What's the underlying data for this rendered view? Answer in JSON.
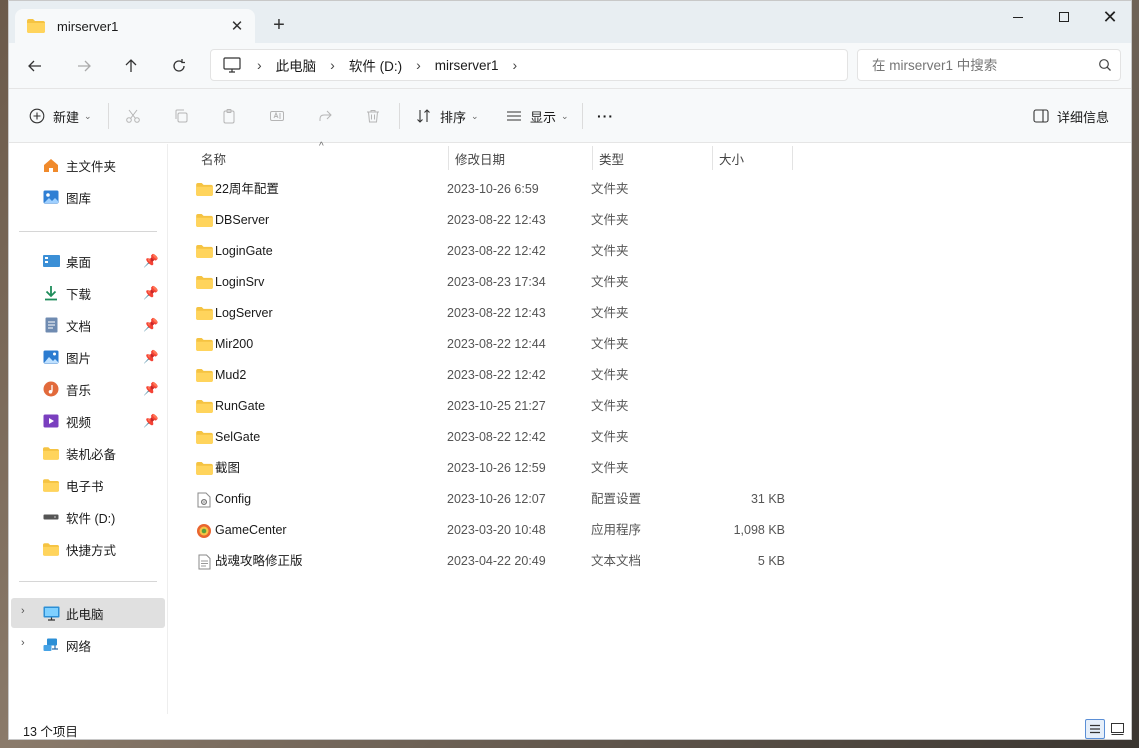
{
  "tab": {
    "title": "mirserver1",
    "close": "✕",
    "new_tab": "+"
  },
  "window_controls": {
    "minimize": "",
    "maximize": "",
    "close": "✕"
  },
  "breadcrumb": [
    "此电脑",
    "软件 (D:)",
    "mirserver1"
  ],
  "search": {
    "placeholder": "在 mirserver1 中搜索"
  },
  "toolbar": {
    "new_label": "新建",
    "sort_label": "排序",
    "view_label": "显示",
    "more_label": "···",
    "details_label": "详细信息"
  },
  "sidebar": {
    "items": [
      {
        "label": "主文件夹",
        "icon": "home-icon"
      },
      {
        "label": "图库",
        "icon": "gallery-icon"
      },
      {
        "label": "桌面",
        "icon": "desktop-icon",
        "pinned": true
      },
      {
        "label": "下载",
        "icon": "download-icon",
        "pinned": true
      },
      {
        "label": "文档",
        "icon": "document-icon",
        "pinned": true
      },
      {
        "label": "图片",
        "icon": "pictures-icon",
        "pinned": true
      },
      {
        "label": "音乐",
        "icon": "music-icon",
        "pinned": true
      },
      {
        "label": "视频",
        "icon": "video-icon",
        "pinned": true
      },
      {
        "label": "装机必备",
        "icon": "folder-icon"
      },
      {
        "label": "电子书",
        "icon": "folder-icon"
      },
      {
        "label": "软件 (D:)",
        "icon": "drive-icon"
      },
      {
        "label": "快捷方式",
        "icon": "folder-icon"
      },
      {
        "label": "此电脑",
        "icon": "this-pc-icon",
        "selected": true
      },
      {
        "label": "网络",
        "icon": "network-icon"
      }
    ]
  },
  "columns": {
    "name": "名称",
    "date": "修改日期",
    "type": "类型",
    "size": "大小"
  },
  "files": [
    {
      "name": "22周年配置",
      "date": "2023-10-26 6:59",
      "type": "文件夹",
      "size": "",
      "icon": "folder-icon"
    },
    {
      "name": "DBServer",
      "date": "2023-08-22 12:43",
      "type": "文件夹",
      "size": "",
      "icon": "folder-icon"
    },
    {
      "name": "LoginGate",
      "date": "2023-08-22 12:42",
      "type": "文件夹",
      "size": "",
      "icon": "folder-icon"
    },
    {
      "name": "LoginSrv",
      "date": "2023-08-23 17:34",
      "type": "文件夹",
      "size": "",
      "icon": "folder-icon"
    },
    {
      "name": "LogServer",
      "date": "2023-08-22 12:43",
      "type": "文件夹",
      "size": "",
      "icon": "folder-icon"
    },
    {
      "name": "Mir200",
      "date": "2023-08-22 12:44",
      "type": "文件夹",
      "size": "",
      "icon": "folder-icon"
    },
    {
      "name": "Mud2",
      "date": "2023-08-22 12:42",
      "type": "文件夹",
      "size": "",
      "icon": "folder-icon"
    },
    {
      "name": "RunGate",
      "date": "2023-10-25 21:27",
      "type": "文件夹",
      "size": "",
      "icon": "folder-icon"
    },
    {
      "name": "SelGate",
      "date": "2023-08-22 12:42",
      "type": "文件夹",
      "size": "",
      "icon": "folder-icon"
    },
    {
      "name": "截图",
      "date": "2023-10-26 12:59",
      "type": "文件夹",
      "size": "",
      "icon": "folder-icon"
    },
    {
      "name": "Config",
      "date": "2023-10-26 12:07",
      "type": "配置设置",
      "size": "31 KB",
      "icon": "config-file-icon"
    },
    {
      "name": "GameCenter",
      "date": "2023-03-20 10:48",
      "type": "应用程序",
      "size": "1,098 KB",
      "icon": "app-icon"
    },
    {
      "name": "战魂攻略修正版",
      "date": "2023-04-22 20:49",
      "type": "文本文档",
      "size": "5 KB",
      "icon": "text-file-icon"
    }
  ],
  "status": {
    "count": "13 个项目"
  },
  "colors": {
    "folder": "#f5c342",
    "accent": "#0067c0",
    "selected_bg": "#e0e0e0"
  }
}
